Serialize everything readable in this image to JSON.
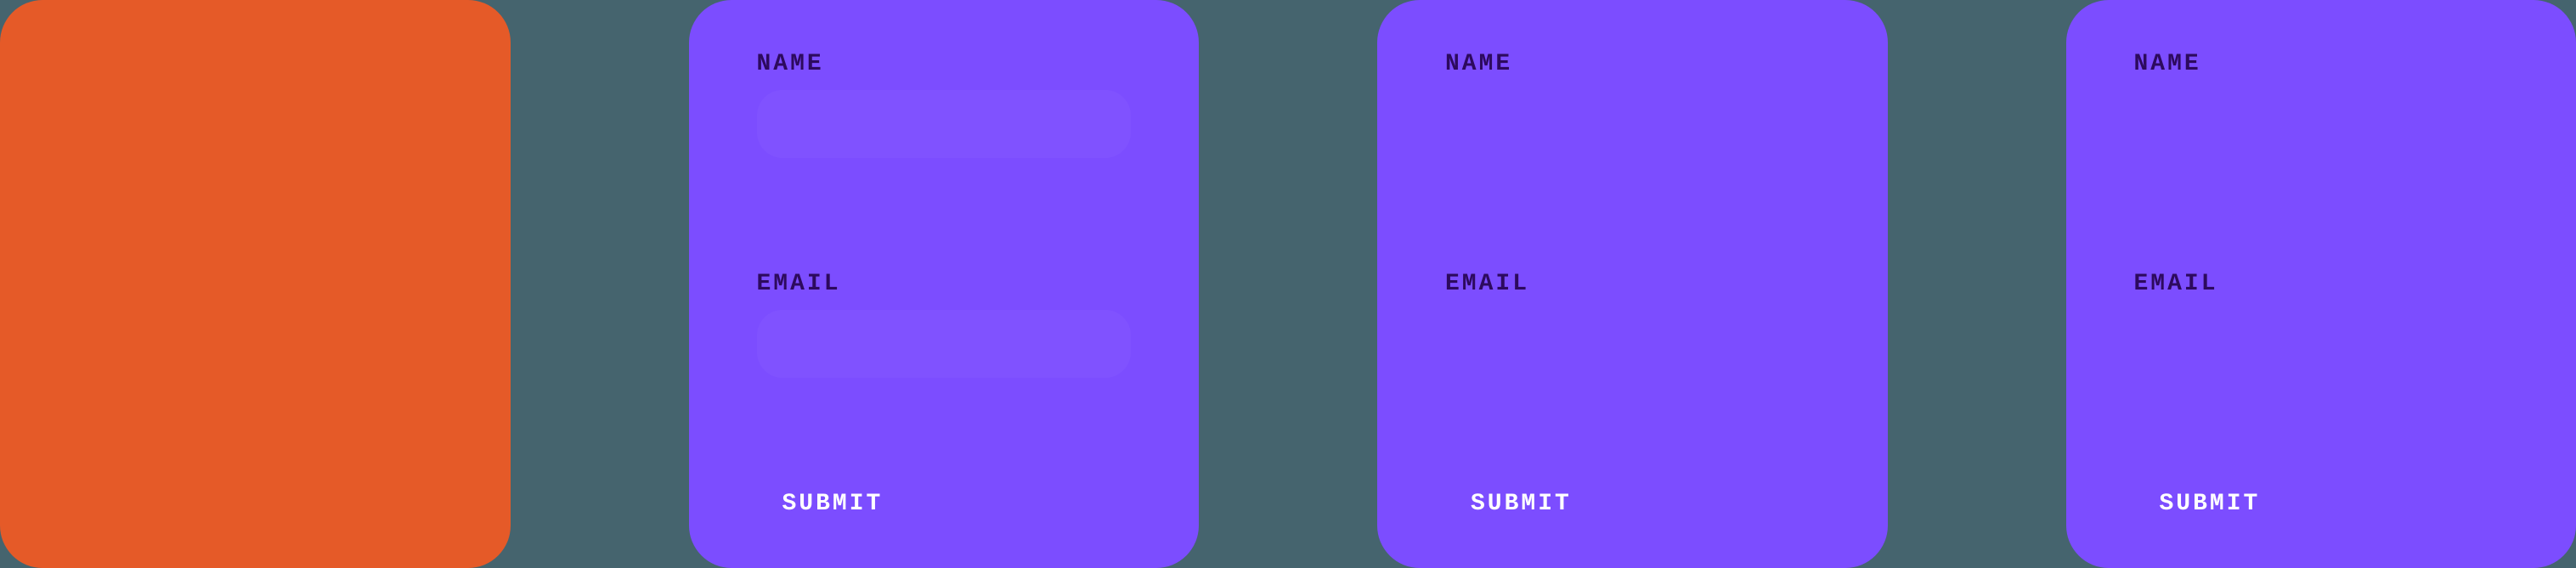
{
  "cards": [
    {
      "type": "orange"
    },
    {
      "type": "purple",
      "fields": {
        "name_label": "NAME",
        "email_label": "EMAIL",
        "submit_label": "SUBMIT"
      }
    },
    {
      "type": "purple",
      "fields": {
        "name_label": "NAME",
        "email_label": "EMAIL",
        "submit_label": "SUBMIT"
      }
    },
    {
      "type": "purple",
      "fields": {
        "name_label": "NAME",
        "email_label": "EMAIL",
        "submit_label": "SUBMIT"
      }
    }
  ],
  "colors": {
    "background": "#45646e",
    "orange": "#e55a28",
    "purple": "#7c4dff",
    "label_text": "#2d0a5e",
    "submit_text": "#ffffff"
  }
}
